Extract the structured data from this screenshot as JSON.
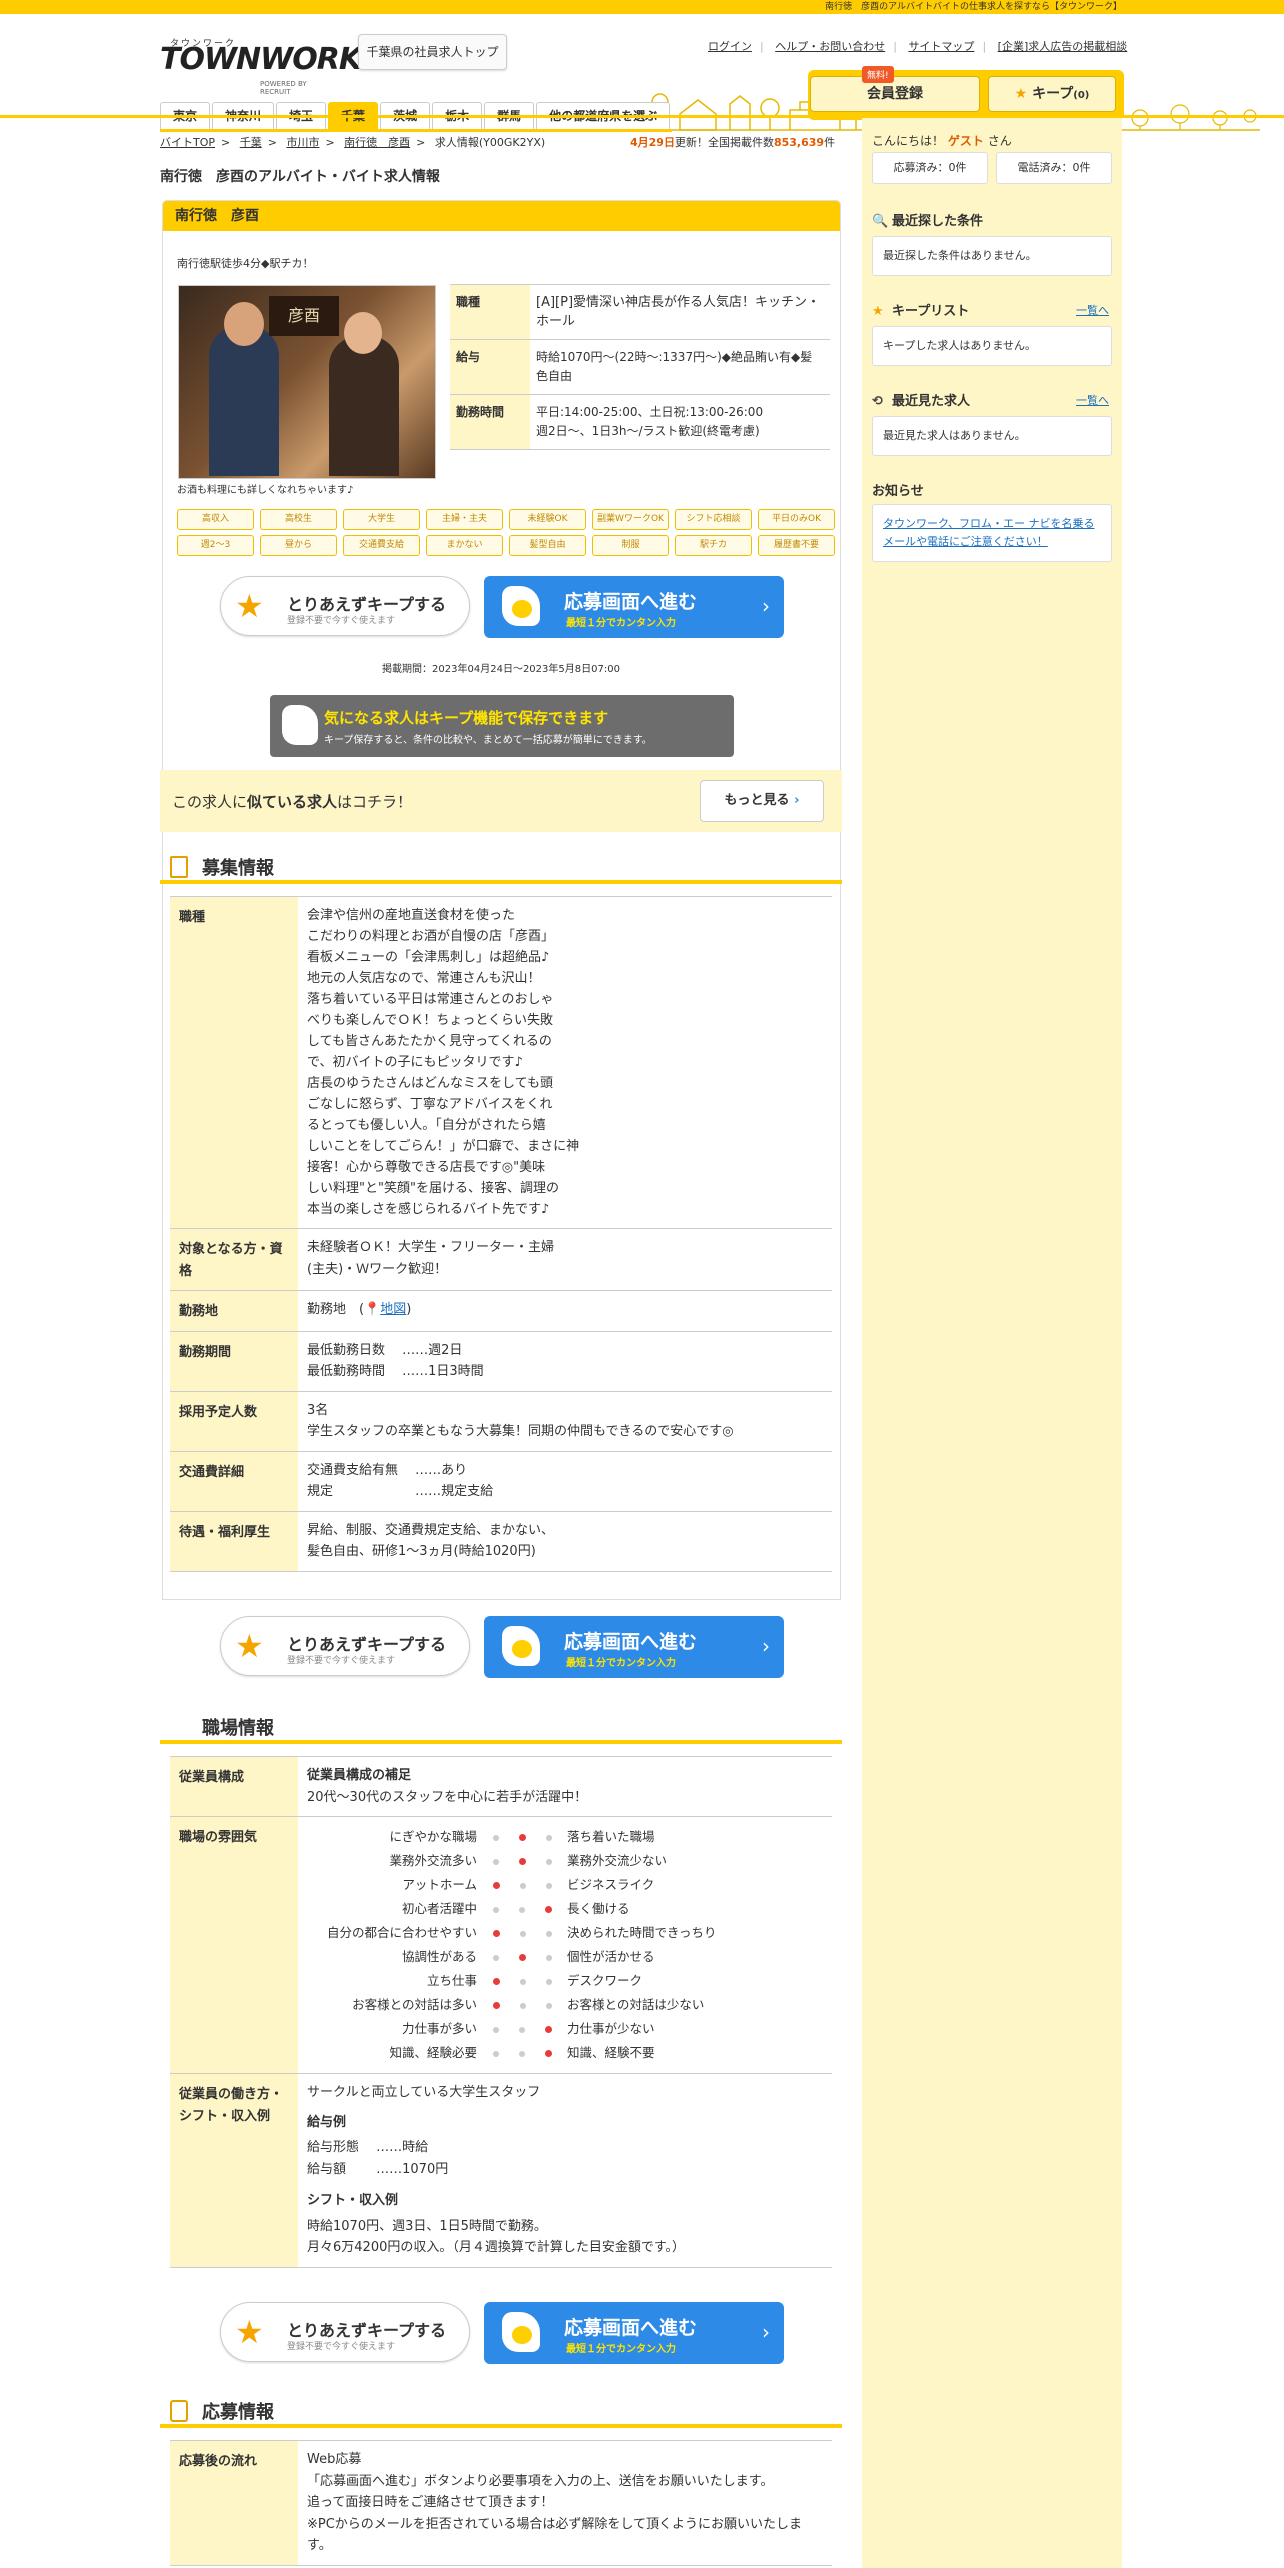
{
  "topbar": {
    "text": "南行徳　彦酉のアルバイトバイトの仕事求人を探すなら【タウンワーク】"
  },
  "header": {
    "logo_kana": "タウンワーク",
    "logo_word": "TOWNWORK",
    "logo_by": "POWERED BY RECRUIT",
    "hq_button": "千葉県の社員求人トップ",
    "links": [
      "ログイン",
      "ヘルプ・お問い合わせ",
      "サイトマップ",
      "[企業]求人広告の掲載相談"
    ],
    "prefs": [
      "東京",
      "神奈川",
      "埼玉",
      "千葉",
      "茨城",
      "栃木",
      "群馬",
      "他の都道府県を選ぶ"
    ],
    "active_pref": "千葉",
    "free_badge": "無料!",
    "register": "会員登録",
    "keep": "キープ",
    "keep_count": "(0)"
  },
  "breadcrumb": [
    "バイトTOP",
    "千葉",
    "市川市",
    "南行徳　彦酉",
    "求人情報(Y00GK2YX)"
  ],
  "update": {
    "date": "4月29日",
    "mid": "更新！全国掲載件数",
    "count": "853,639",
    "unit": "件"
  },
  "page_title": "南行徳　彦酉のアルバイト・バイト求人情報",
  "job": {
    "name": "南行徳　彦酉",
    "catch": "南行徳駅徒歩4分◆駅チカ！",
    "photo_caption": "お酒も料理にも詳しくなれちゃいます♪",
    "sign": "彦酉",
    "summary": [
      {
        "h": "職種",
        "v": "[A][P]愛情深い神店長が作る人気店！キッチン・ホール"
      },
      {
        "h": "給与",
        "v": "時給1070円～(22時～:1337円～)◆絶品賄い有◆髪色自由"
      },
      {
        "h": "勤務時間",
        "v": "平日:14:00-25:00、土日祝:13:00-26:00\n週2日～、1日3h～/ラスト歓迎(終電考慮)"
      }
    ],
    "tags": [
      "高収入",
      "高校生",
      "大学生",
      "主婦・主夫",
      "未経験OK",
      "副業WワークOK",
      "シフト応相談",
      "平日のみOK",
      "週2～3",
      "昼から",
      "交通費支給",
      "まかない",
      "髪型自由",
      "制服",
      "駅チカ",
      "履歴書不要"
    ],
    "period": "掲載期間：2023年04月24日～2023年5月8日07:00"
  },
  "buttons": {
    "keep_main": "とりあえずキープする",
    "keep_sub": "登録不要で今すぐ使えます",
    "apply_main": "応募画面へ進む",
    "apply_sub": "最短１分でカンタン入力",
    "chevron": "›"
  },
  "keep_banner": {
    "main": "気になる求人はキープ機能で保存できます",
    "sub": "キープ保存すると、条件の比較や、まとめて一括応募が簡単にできます。"
  },
  "similar": {
    "pre": "この求人に",
    "bold": "似ている求人",
    "post": "はコチラ！",
    "more": "もっと見る",
    "more_arrow": "›"
  },
  "recruit": {
    "title": "募集情報",
    "rows": [
      {
        "h": "職種",
        "v": "会津や信州の産地直送食材を使った\nこだわりの料理とお酒が自慢の店「彦酉」\n看板メニューの「会津馬刺し」は超絶品♪\n地元の人気店なので、常連さんも沢山！\n落ち着いている平日は常連さんとのおしゃ\nべりも楽しんでＯＫ！ちょっとくらい失敗\nしても皆さんあたたかく見守ってくれるの\nで、初バイトの子にもピッタリです♪\n店長のゆうたさんはどんなミスをしても頭\nごなしに怒らず、丁寧なアドバイスをくれ\nるとっても優しい人。「自分がされたら嬉\nしいことをしてごらん！」が口癖で、まさに神\n接客！心から尊敬できる店長です◎\"美味\nしい料理\"と\"笑顔\"を届ける、接客、調理の\n本当の楽しさを感じられるバイト先です♪"
      },
      {
        "h": "対象となる方・資格",
        "v": "未経験者ＯＫ！大学生・フリーター・主婦\n(主夫)・Ｗワーク歓迎！"
      },
      {
        "h": "勤務地",
        "v": "勤務地　(",
        "map": "地図",
        "close": ")"
      },
      {
        "h": "勤務期間",
        "v": "最低勤務日数　 ……週2日\n最低勤務時間　 ……1日3時間"
      },
      {
        "h": "採用予定人数",
        "v": "3名\n学生スタッフの卒業ともなう大募集！同期の仲間もできるので安心です◎"
      },
      {
        "h": "交通費詳細",
        "v": "交通費支給有無　 ……あり\n規定　　　　　　 ……規定支給"
      },
      {
        "h": "待遇・福利厚生",
        "v": "昇給、制服、交通費規定支給、まかない、\n髪色自由、研修1～3ヵ月(時給1020円)"
      }
    ]
  },
  "workplace": {
    "title": "職場情報",
    "composition_h": "従業員構成",
    "composition_sub": "従業員構成の補足",
    "composition_v": "20代～30代のスタッフを中心に若手が活躍中！",
    "atmosphere_h": "職場の雰囲気",
    "atmosphere": [
      {
        "l": "にぎやかな職場",
        "r": "落ち着いた職場",
        "level": 2
      },
      {
        "l": "業務外交流多い",
        "r": "業務外交流少ない",
        "level": 2
      },
      {
        "l": "アットホーム",
        "r": "ビジネスライク",
        "level": 1
      },
      {
        "l": "初心者活躍中",
        "r": "長く働ける",
        "level": 3
      },
      {
        "l": "自分の都合に合わせやすい",
        "r": "決められた時間できっちり",
        "level": 1
      },
      {
        "l": "協調性がある",
        "r": "個性が活かせる",
        "level": 2
      },
      {
        "l": "立ち仕事",
        "r": "デスクワーク",
        "level": 1
      },
      {
        "l": "お客様との対話は多い",
        "r": "お客様との対話は少ない",
        "level": 1
      },
      {
        "l": "力仕事が多い",
        "r": "力仕事が少ない",
        "level": 3
      },
      {
        "l": "知識、経験必要",
        "r": "知識、経験不要",
        "level": 3
      }
    ],
    "style_h": "従業員の働き方・シフト・収入例",
    "style_intro": "サークルと両立している大学生スタッフ",
    "pay_h": "給与例",
    "pay_v": "給与形態　 ……時給\n給与額　　 ……1070円",
    "shift_h": "シフト・収入例",
    "shift_v": "時給1070円、週3日、1日5時間で勤務。\n月々6万4200円の収入。（月４週換算で計算した目安金額です。）"
  },
  "apply": {
    "title": "応募情報",
    "flow_h": "応募後の流れ",
    "flow_v": "Web応募\n「応募画面へ進む」ボタンより必要事項を入力の上、送信をお願いいたします。\n追って面接日時をご連絡させて頂きます！\n※PCからのメールを拒否されている場合は必ず解除をして頂くようにお願いいたします。"
  },
  "sidebar": {
    "greet_pre": "こんにちは！",
    "guest": "ゲスト",
    "greet_post": "さん",
    "applied": "応募済み：0件",
    "called": "電話済み：0件",
    "recent_search": "最近探した条件",
    "recent_search_empty": "最近探した条件はありません。",
    "keeplist": "キープリスト",
    "keeplist_link": "一覧へ",
    "keeplist_empty": "キープした求人はありません。",
    "recent_view": "最近見た求人",
    "recent_view_link": "一覧へ",
    "recent_view_empty": "最近見た求人はありません。",
    "notice": "お知らせ",
    "notice_link": "タウンワーク、フロム・エー ナビを名乗るメールや電話にご注意ください！"
  }
}
